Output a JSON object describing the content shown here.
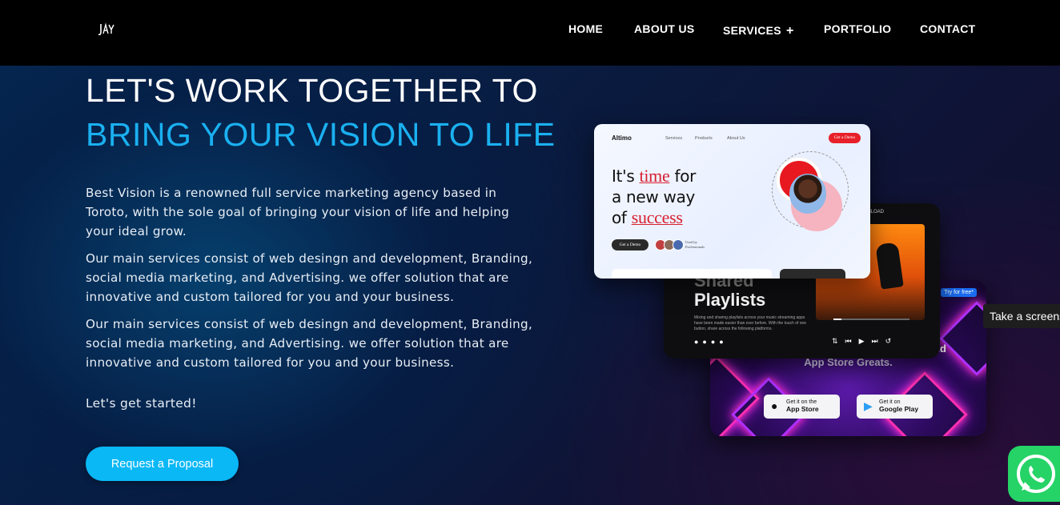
{
  "header": {
    "logo_text": "JAY",
    "nav": [
      {
        "label": "HOME"
      },
      {
        "label": "ABOUT US"
      },
      {
        "label": "SERVICES"
      },
      {
        "label": "PORTFOLIO"
      },
      {
        "label": "CONTACT"
      }
    ],
    "services_plus": "+"
  },
  "hero": {
    "title_line1": "LET'S WORK TOGETHER TO",
    "title_line2": "BRING YOUR VISION TO LIFE",
    "paragraphs": [
      "Best Vision is a renowned full service marketing agency based in Toroto, with the sole goal of bringing your vision of life and helping your ideal grow.",
      "Our main services consist of web desingn and development, Branding, social media marketing, and Advertising. we offer solution that are innovative and custom tailored for you and your business.",
      "Our main services consist of web desingn and development, Branding, social media marketing, and Advertising. we offer solution that are innovative and custom tailored for you and your business."
    ],
    "cta_text": "Let's get started!",
    "button_label": "Request a Proposal",
    "accent_color": "#1ab0f0",
    "button_color": "#0ab8f6"
  },
  "mockups": {
    "altimo": {
      "brand": "Altimo",
      "nav": [
        "Services",
        "Products",
        "About Us"
      ],
      "demo": "Get a Demo",
      "headline_1": "It's ",
      "headline_2": "time",
      "headline_3": " for",
      "headline_4": "a new way",
      "headline_5": "of ",
      "headline_6": "success",
      "pill": "Get a Demo",
      "pros": "Used by\nProfessionals"
    },
    "music": {
      "download": "DOWNLOAD",
      "title_1": "Shared",
      "title_2": "Playlists",
      "description": "Mixing and sharing playlists across your music streaming apps have been made easier than ever before. With the touch of one button, share across the following platforms."
    },
    "appstore": {
      "tag": "Try for free*",
      "line1": "nd",
      "line2": "App Store Greats.",
      "apple_small": "Get it on the",
      "apple_big": "App Store",
      "google_small": "Get it on",
      "google_big": "Google Play"
    }
  },
  "overlay": {
    "screenshot_tip": "Take a screenshot"
  },
  "icons": {
    "logo": "jay-logo-icon",
    "whatsapp": "whatsapp-icon"
  }
}
